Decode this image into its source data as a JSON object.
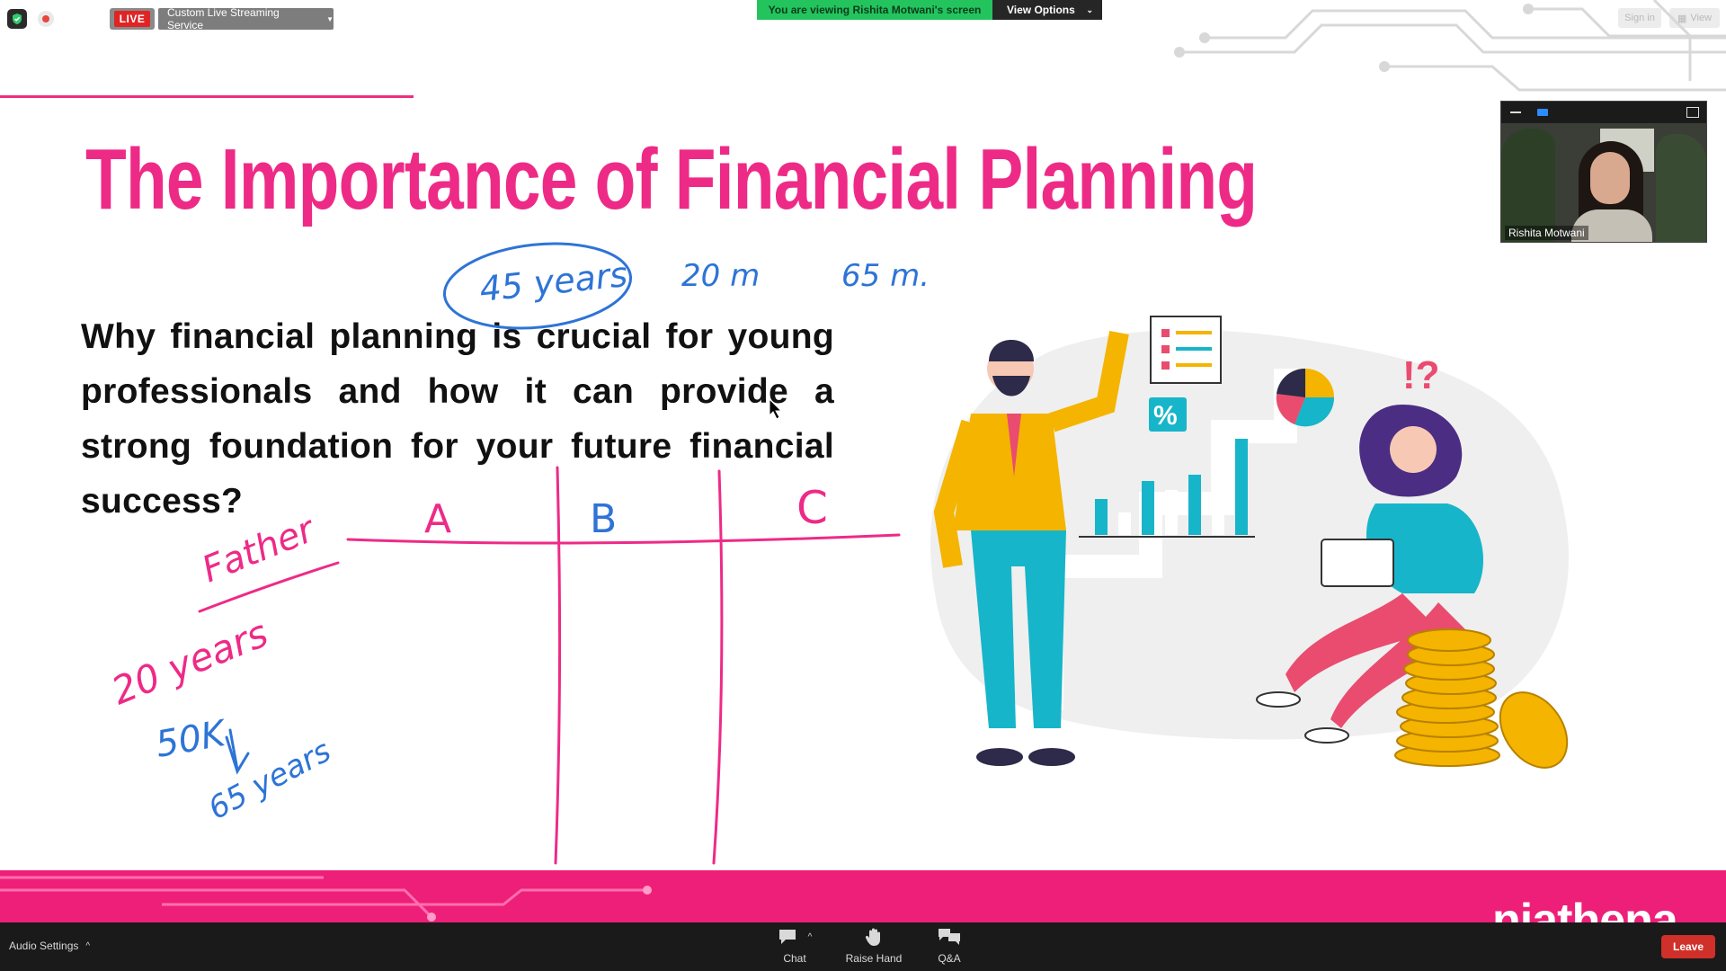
{
  "zoom_top": {
    "live_badge": "LIVE",
    "streaming_service": "Custom Live Streaming Service",
    "viewing_banner": "You are viewing Rishita Motwani's screen",
    "view_options": "View Options",
    "sign_in": "Sign in",
    "view": "View"
  },
  "slide": {
    "title": "The Importance of Financial Planning",
    "body": "Why financial planning is crucial for young professionals and how it can provide a strong foundation for your future financial success?",
    "brand": "niathena"
  },
  "annotations": {
    "blue_top": [
      "45 years",
      "20 m",
      "65 m."
    ],
    "columns": [
      "A",
      "B",
      "C"
    ],
    "pink_left": [
      "Father",
      "20 years"
    ],
    "blue_left": [
      "50K",
      "65 years"
    ]
  },
  "video_tile": {
    "participant_name": "Rishita Motwani"
  },
  "toolbar": {
    "audio_settings": "Audio Settings",
    "chat": "Chat",
    "raise_hand": "Raise Hand",
    "qa": "Q&A",
    "leave": "Leave"
  },
  "colors": {
    "accent_pink": "#ee2a87",
    "annotation_blue": "#2e74d6",
    "zoom_green": "#23c45e",
    "leave_red": "#d0302a"
  },
  "icons": [
    "shield-icon",
    "record-icon",
    "chat-icon",
    "hand-icon",
    "qa-icon",
    "chevron-down-icon",
    "chevron-up-icon",
    "cursor-icon"
  ]
}
